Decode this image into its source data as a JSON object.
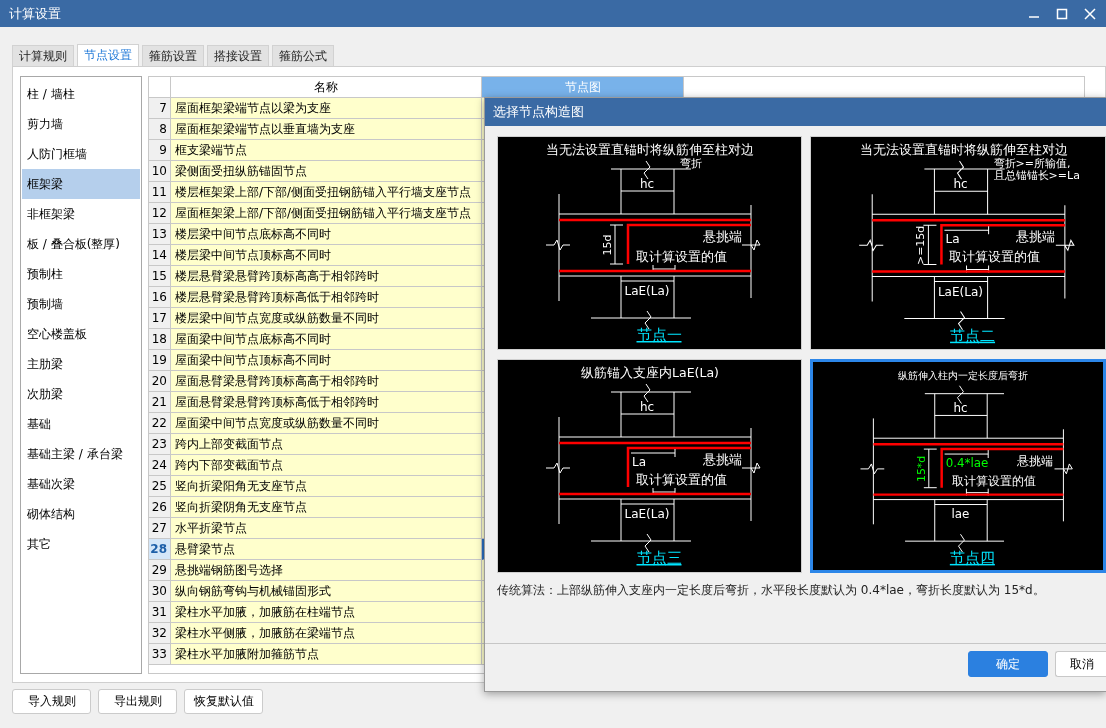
{
  "window": {
    "title": "计算设置"
  },
  "tabs": [
    {
      "label": "计算规则",
      "selected": false
    },
    {
      "label": "节点设置",
      "selected": true
    },
    {
      "label": "箍筋设置",
      "selected": false
    },
    {
      "label": "搭接设置",
      "selected": false
    },
    {
      "label": "箍筋公式",
      "selected": false
    }
  ],
  "categories": [
    {
      "label": "柱 / 墙柱",
      "selected": false
    },
    {
      "label": "剪力墙",
      "selected": false
    },
    {
      "label": "人防门框墙",
      "selected": false
    },
    {
      "label": "框架梁",
      "selected": true
    },
    {
      "label": "非框架梁",
      "selected": false
    },
    {
      "label": "板 / 叠合板(整厚)",
      "selected": false
    },
    {
      "label": "预制柱",
      "selected": false
    },
    {
      "label": "预制墙",
      "selected": false
    },
    {
      "label": "空心楼盖板",
      "selected": false
    },
    {
      "label": "主肋梁",
      "selected": false
    },
    {
      "label": "次肋梁",
      "selected": false
    },
    {
      "label": "基础",
      "selected": false
    },
    {
      "label": "基础主梁 / 承台梁",
      "selected": false
    },
    {
      "label": "基础次梁",
      "selected": false
    },
    {
      "label": "砌体结构",
      "selected": false
    },
    {
      "label": "其它",
      "selected": false
    }
  ],
  "table": {
    "columns": [
      {
        "label": "名称",
        "selected": false
      },
      {
        "label": "节点图",
        "selected": true
      }
    ],
    "rows": [
      {
        "number": "7",
        "name": "屋面框架梁端节点以梁为支座",
        "selected": false
      },
      {
        "number": "8",
        "name": "屋面框架梁端节点以垂直墙为支座",
        "selected": false
      },
      {
        "number": "9",
        "name": "框支梁端节点",
        "selected": false
      },
      {
        "number": "10",
        "name": "梁侧面受扭纵筋锚固节点",
        "selected": false
      },
      {
        "number": "11",
        "name": "楼层框架梁上部/下部/侧面受扭钢筋锚入平行墙支座节点",
        "selected": false
      },
      {
        "number": "12",
        "name": "屋面框架梁上部/下部/侧面受扭钢筋锚入平行墙支座节点",
        "selected": false
      },
      {
        "number": "13",
        "name": "楼层梁中间节点底标高不同时",
        "selected": false
      },
      {
        "number": "14",
        "name": "楼层梁中间节点顶标高不同时",
        "selected": false
      },
      {
        "number": "15",
        "name": "楼层悬臂梁悬臂跨顶标高高于相邻跨时",
        "selected": false
      },
      {
        "number": "16",
        "name": "楼层悬臂梁悬臂跨顶标高低于相邻跨时",
        "selected": false
      },
      {
        "number": "17",
        "name": "楼层梁中间节点宽度或纵筋数量不同时",
        "selected": false
      },
      {
        "number": "18",
        "name": "屋面梁中间节点底标高不同时",
        "selected": false
      },
      {
        "number": "19",
        "name": "屋面梁中间节点顶标高不同时",
        "selected": false
      },
      {
        "number": "20",
        "name": "屋面悬臂梁悬臂跨顶标高高于相邻跨时",
        "selected": false
      },
      {
        "number": "21",
        "name": "屋面悬臂梁悬臂跨顶标高低于相邻跨时",
        "selected": false
      },
      {
        "number": "22",
        "name": "屋面梁中间节点宽度或纵筋数量不同时",
        "selected": false
      },
      {
        "number": "23",
        "name": "跨内上部变截面节点",
        "selected": false
      },
      {
        "number": "24",
        "name": "跨内下部变截面节点",
        "selected": false
      },
      {
        "number": "25",
        "name": "竖向折梁阳角无支座节点",
        "selected": false
      },
      {
        "number": "26",
        "name": "竖向折梁阴角无支座节点",
        "selected": false
      },
      {
        "number": "27",
        "name": "水平折梁节点",
        "selected": false
      },
      {
        "number": "28",
        "name": "悬臂梁节点",
        "selected": true
      },
      {
        "number": "29",
        "name": "悬挑端钢筋图号选择",
        "selected": false
      },
      {
        "number": "30",
        "name": "纵向钢筋弯钩与机械锚固形式",
        "selected": false
      },
      {
        "number": "31",
        "name": "梁柱水平加腋，加腋筋在柱端节点",
        "selected": false
      },
      {
        "number": "32",
        "name": "梁柱水平侧腋，加腋筋在梁端节点",
        "selected": false
      },
      {
        "number": "33",
        "name": "梁柱水平加腋附加箍筋节点",
        "selected": false
      }
    ]
  },
  "buttons": [
    "导入规则",
    "导出规则",
    "恢复默认值"
  ],
  "dialog": {
    "title": "选择节点构造图",
    "nodes": [
      {
        "label": "节点一",
        "selected": false,
        "small_title": false,
        "title_lines": [
          "当无法设置直锚时将纵筋伸至柱对边",
          "弯折"
        ],
        "hc": "hc",
        "vertical_dim": "15d",
        "cantilever": "悬挑端",
        "note": "取计算设置的值",
        "bottom_dim": "LaE(La)",
        "dims_highlighted": false
      },
      {
        "label": "节点二",
        "selected": false,
        "small_title": false,
        "title_lines": [
          "当无法设置直锚时将纵筋伸至柱对边",
          "弯折>=所输值,",
          "且总锚锚长>=La"
        ],
        "hc": "hc",
        "vertical_dim": ">=15d",
        "horizontal_dim": "La",
        "cantilever": "悬挑端",
        "note": "取计算设置的值",
        "bottom_dim": "LaE(La)",
        "dims_highlighted": false
      },
      {
        "label": "节点三",
        "selected": false,
        "small_title": false,
        "title_lines": [
          "纵筋锚入支座内LaE(La)"
        ],
        "hc": "hc",
        "horizontal_dim": "La",
        "cantilever": "悬挑端",
        "note": "取计算设置的值",
        "bottom_dim": "LaE(La)",
        "dims_highlighted": false
      },
      {
        "label": "节点四",
        "selected": true,
        "small_title": true,
        "title_lines": [
          "纵筋伸入柱内一定长度后弯折"
        ],
        "hc": "hc",
        "vertical_dim": "15*d",
        "horizontal_dim": "0.4*lae",
        "cantilever": "悬挑端",
        "note": "取计算设置的值",
        "bottom_dim": "lae",
        "dims_highlighted": true
      }
    ],
    "description": "传统算法：上部纵筋伸入支座内一定长度后弯折，水平段长度默认为 0.4*lae，弯折长度默认为 15*d。",
    "buttons": [
      {
        "label": "确定",
        "primary": true
      },
      {
        "label": "取消",
        "primary": false
      }
    ]
  }
}
